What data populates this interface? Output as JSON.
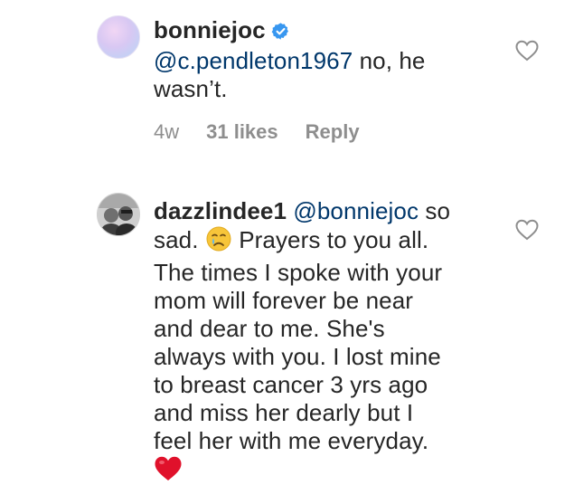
{
  "comments": [
    {
      "username": "bonniejoc",
      "verified": true,
      "mention": "@c.pendleton1967",
      "text_line1_rest": " no, he",
      "text_line2": "wasn’t.",
      "time": "4w",
      "likes": "31 likes",
      "reply": "Reply"
    },
    {
      "username": "dazzlindee1",
      "mention": "@bonniejoc",
      "line1_rest": " so",
      "line2_before_emoji": "sad. ",
      "line2_after_emoji": "  Prayers to you all.",
      "line3": "The times I spoke with your",
      "line4": "mom will forever be near",
      "line5": "and dear to me. She's",
      "line6": "always with you. I lost mine",
      "line7": "to breast cancer 3 yrs ago",
      "line8": "and miss her dearly but I",
      "line9": "feel her with me everyday."
    }
  ],
  "icons": {
    "verified": "verified-badge-icon",
    "heart_outline": "heart-outline-icon",
    "crying_emoji": "crying-face-emoji",
    "red_heart_emoji": "red-heart-emoji"
  },
  "colors": {
    "mention": "#00376b",
    "meta": "#8e8e8e",
    "verified": "#3897f0",
    "heart_emoji": "#e0112b"
  }
}
